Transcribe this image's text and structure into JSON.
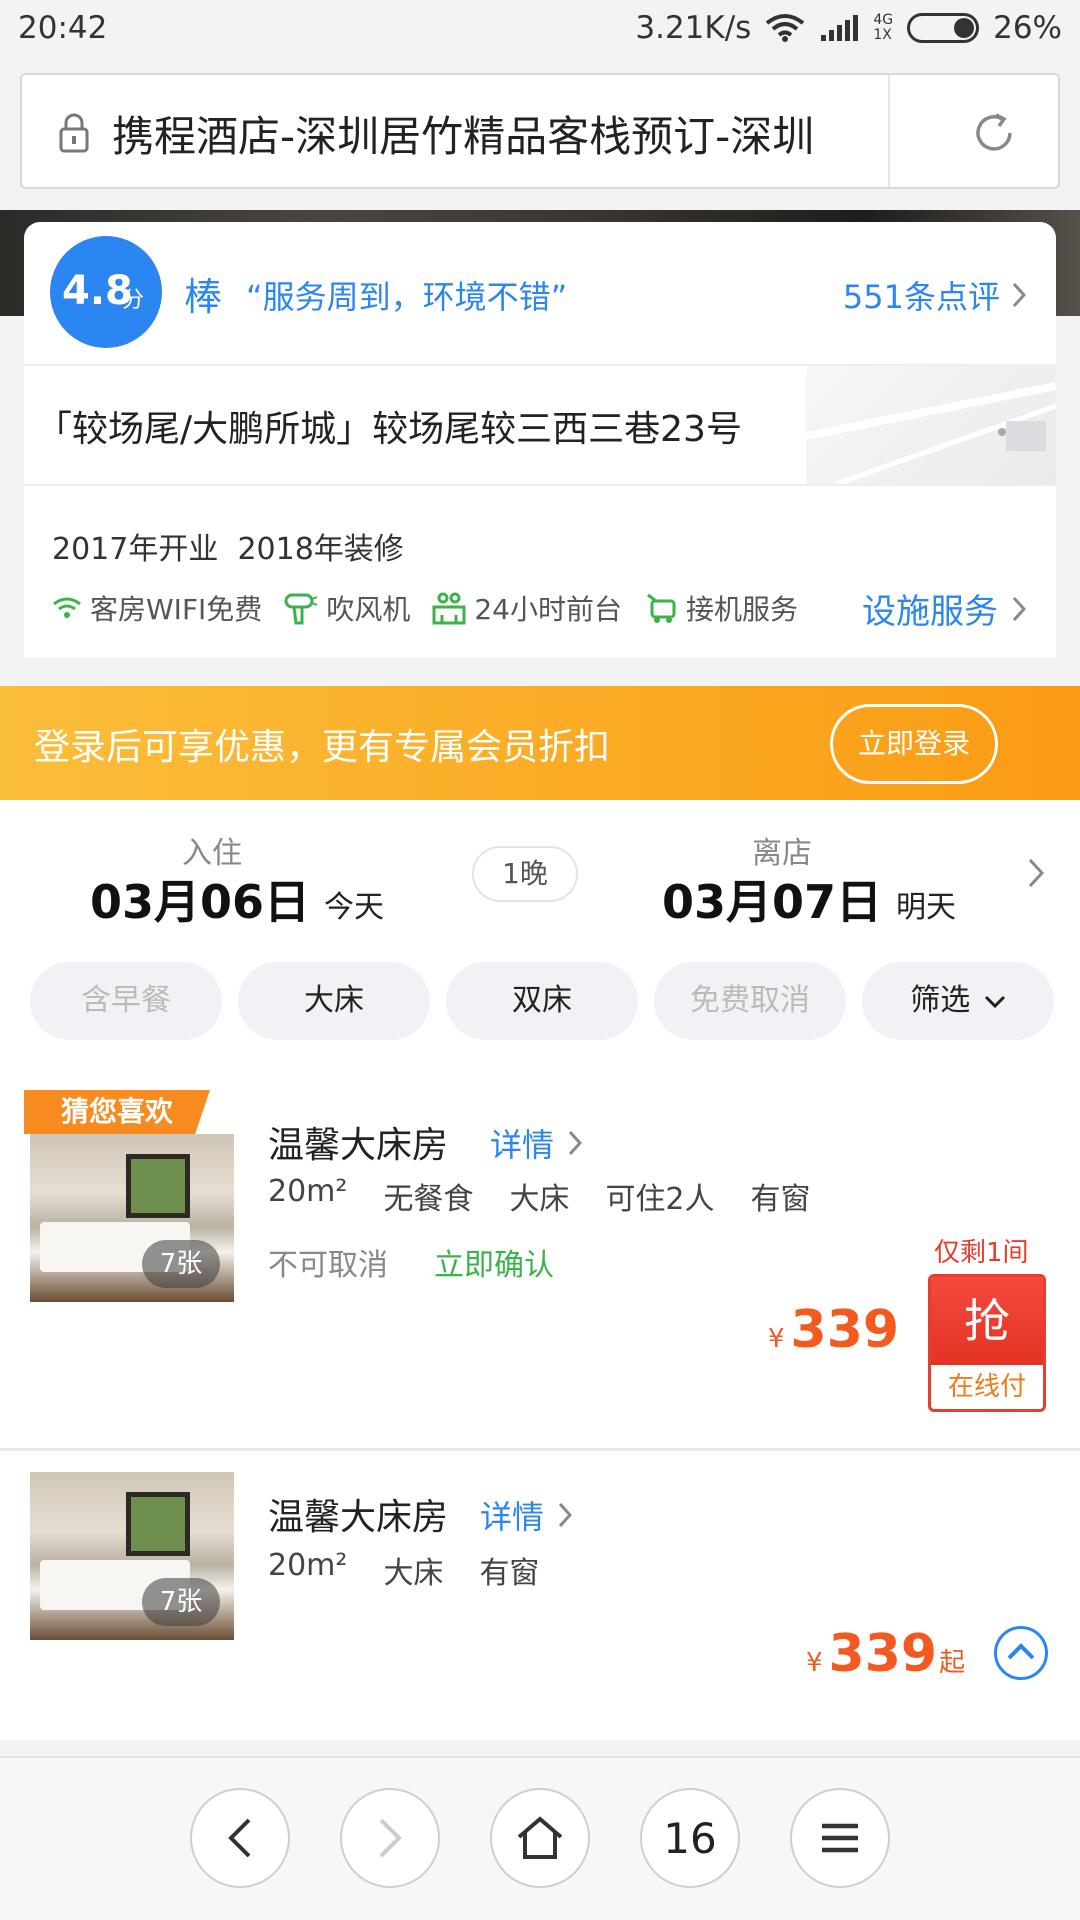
{
  "status_bar": {
    "time": "20:42",
    "net_speed": "3.21K/s",
    "net_tag_top": "4G",
    "net_tag_bottom": "1X",
    "battery": "26%"
  },
  "url_bar": {
    "title": "携程酒店-深圳居竹精品客栈预订-深圳"
  },
  "rating": {
    "score": "4.8",
    "unit": "分",
    "word": "棒",
    "quote": "“服务周到，环境不错”",
    "reviews": "551条点评"
  },
  "address": "「较场尾/大鹏所城」较场尾较三西三巷23号",
  "hotel_info": {
    "opened": "2017年开业",
    "renovated": "2018年装修",
    "facilities": [
      {
        "label": "客房WIFI免费",
        "icon": "wifi-icon"
      },
      {
        "label": "吹风机",
        "icon": "hairdryer-icon"
      },
      {
        "label": "24小时前台",
        "icon": "front-desk-icon"
      },
      {
        "label": "接机服务",
        "icon": "shuttle-icon"
      }
    ],
    "facility_link": "设施服务"
  },
  "login_banner": {
    "text": "登录后可享优惠，更有专属会员折扣",
    "button": "立即登录"
  },
  "stay": {
    "checkin_label": "入住",
    "checkin_date": "03月06日",
    "checkin_rel": "今天",
    "nights": "1晚",
    "checkout_label": "离店",
    "checkout_date": "03月07日",
    "checkout_rel": "明天"
  },
  "filters": [
    {
      "label": "含早餐",
      "disabled": true
    },
    {
      "label": "大床",
      "disabled": false
    },
    {
      "label": "双床",
      "disabled": false
    },
    {
      "label": "免费取消",
      "disabled": true
    },
    {
      "label": "筛选",
      "disabled": false
    }
  ],
  "rooms": [
    {
      "tag": "猜您喜欢",
      "title": "温馨大床房",
      "detail": "详情",
      "specs": [
        "20m²",
        "无餐食",
        "大床",
        "可住2人",
        "有窗"
      ],
      "cancel": "不可取消",
      "confirm": "立即确认",
      "photos": "7张",
      "left": "仅剩1间",
      "currency": "¥",
      "price": "339",
      "grab": "抢",
      "pay": "在线付"
    },
    {
      "title": "温馨大床房",
      "detail": "详情",
      "specs": [
        "20m²",
        "大床",
        "有窗"
      ],
      "photos": "7张",
      "currency": "¥",
      "price": "339",
      "suffix": "起"
    }
  ],
  "bottom_nav": {
    "tabs": "16"
  },
  "colors": {
    "accent_blue": "#2c86f2",
    "price_orange": "#f35a1f",
    "banner_orange": "#fb9b14",
    "confirm_green": "#3cb24a",
    "alert_red": "#e53d2f"
  }
}
